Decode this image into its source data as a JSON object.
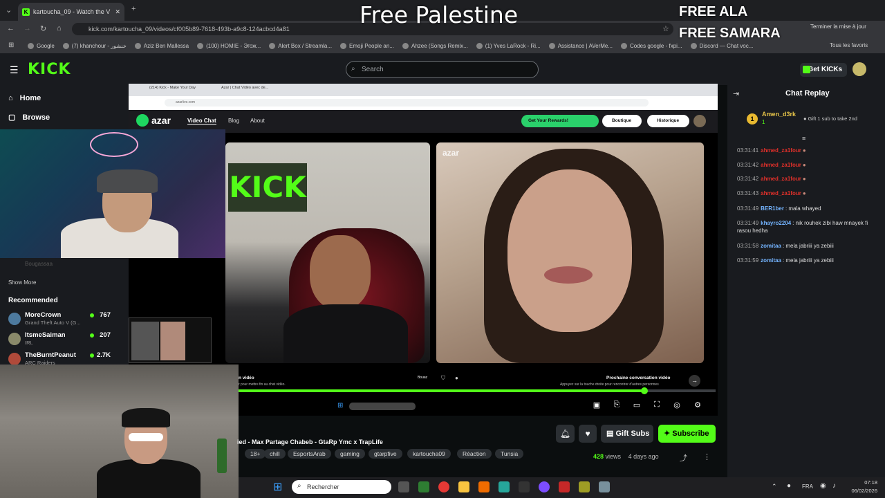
{
  "browser": {
    "tab_title": "kartoucha_09 - Watch the V",
    "url": "kick.com/kartoucha_09/videos/cf005b89-7618-493b-a9c8-124acbcd4a81",
    "finish_update": "Terminer la mise à jour",
    "bookmarks": [
      "Google",
      "(7) khanchour - خنشور",
      "Aziz Ben Mallessa",
      "(100) HOMIE - Эгож...",
      "Alert Box / Streamla...",
      "Emoji People an...",
      "Ahzee (Songs Remix...",
      "(1) Yves LaRock - Ri...",
      "Assistance | AVerMe...",
      "Codes google - fxpi...",
      "Discord — Chat voc..."
    ],
    "all_bookmarks": "Tous les favoris"
  },
  "overlays": {
    "palestine": "Free Palestine",
    "ala": "FREE ALA",
    "samara": "FREE SAMARA"
  },
  "kick": {
    "logo": "KICK",
    "search_placeholder": "Search",
    "get_kicks": "Get KICKs",
    "nav_home": "Home",
    "nav_browse": "Browse",
    "followed_dim": "Bougassaa",
    "show_more": "Show More",
    "recommended_title": "Recommended",
    "recommended": [
      {
        "name": "MoreCrown",
        "game": "Grand Theft Auto V (G...",
        "viewers": "767"
      },
      {
        "name": "ItsmeSaiman",
        "game": "IRL",
        "viewers": "207"
      },
      {
        "name": "TheBurntPeanut",
        "game": "ARC Raiders",
        "viewers": "2.7K"
      }
    ]
  },
  "azar": {
    "tab1": "(214) Kick - Make Your Day",
    "tab2": "Azar | Chat Vidéo avec de...",
    "url": "azarlive.com",
    "logo": "azar",
    "nav": [
      "Video Chat",
      "Blog",
      "About"
    ],
    "rewards": "Get Your Rewards!",
    "boutique": "Boutique",
    "historique": "Historique",
    "watermark": "azar",
    "wall_sign": "KICK",
    "left_caption": "n vidéo",
    "left_sub": "r pour mettre fin au chat vidéo.",
    "center_label": "Bouaz",
    "next_title": "Prochaine conversation vidéo",
    "next_sub": "Appuyez sur la touche droite pour rencontrer d'autres personnes"
  },
  "video": {
    "progress": 0.85,
    "title": "ied - Max Partage Chabeb - GtaRp Ymc x TrapLife",
    "tags": [
      "18+",
      "chill",
      "EsportsArab",
      "gaming",
      "gtarpfive",
      "kartoucha09",
      "Réaction",
      "Tunsia"
    ],
    "views": "428",
    "views_label": "views",
    "age": "4 days ago",
    "gift_subs": "Gift Subs",
    "subscribe": "Subscribe"
  },
  "chat": {
    "title": "Chat Replay",
    "pinned_user": "Amen_d3rk",
    "pinned_rank": "1",
    "pinned_count": "1",
    "pinned_gift": "Gift 1 sub to take 2nd",
    "messages": [
      {
        "time": "03:31:41",
        "user": "ahmed_za1four",
        "text": "",
        "color": "#e0302a"
      },
      {
        "time": "03:31:42",
        "user": "ahmed_za1four",
        "text": "",
        "color": "#e0302a"
      },
      {
        "time": "03:31:42",
        "user": "ahmed_za1four",
        "text": "",
        "color": "#e0302a"
      },
      {
        "time": "03:31:43",
        "user": "ahmed_za1four",
        "text": "",
        "color": "#e0302a"
      },
      {
        "time": "03:31:49",
        "user": "BER1ber",
        "text": "mala whayed",
        "color": "#74b4ff"
      },
      {
        "time": "03:31:49",
        "user": "khayro2204",
        "text": "nik rouhek zibi haw mnayek fi rasou hedha",
        "color": "#74b4ff"
      },
      {
        "time": "03:31:58",
        "user": "zomitaa",
        "text": "mela jabriii ya zebiii",
        "color": "#74b4ff"
      },
      {
        "time": "03:31:59",
        "user": "zomitaa",
        "text": "mela jabriii ya zebiii",
        "color": "#74b4ff"
      }
    ]
  },
  "taskbar": {
    "search": "Rechercher",
    "lang": "FRA",
    "time": "07:18",
    "date": "06/02/2026"
  }
}
